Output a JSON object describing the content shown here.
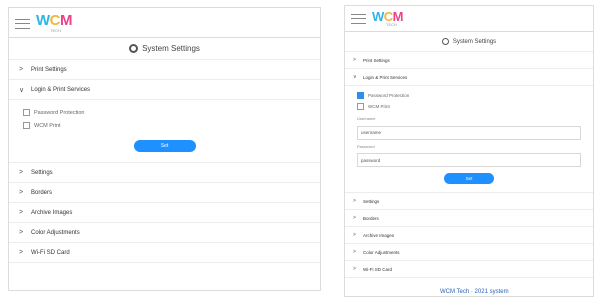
{
  "brand": {
    "logo_w": "W",
    "logo_c": "C",
    "logo_m": "M",
    "logo_sub": "TECH"
  },
  "title": "System Settings",
  "left": {
    "sections_top": [
      "Print Settings"
    ],
    "expanded_label": "Login & Print Services",
    "checkboxes": [
      {
        "label": "Password Protection",
        "checked": false
      },
      {
        "label": "WCM Print",
        "checked": false
      }
    ],
    "button": "Set",
    "sections_bottom": [
      "Settings",
      "Borders",
      "Archive Images",
      "Color Adjustments",
      "Wi-Fi SD Card"
    ]
  },
  "right": {
    "sections_top": [
      "Print Settings"
    ],
    "expanded_label": "Login & Print Services",
    "checkboxes": [
      {
        "label": "Password Protection",
        "checked": true
      },
      {
        "label": "WCM Print",
        "checked": false
      }
    ],
    "fields": [
      {
        "label": "Username",
        "value": "username"
      },
      {
        "label": "Password",
        "value": "password"
      }
    ],
    "button": "Set",
    "sections_bottom": [
      "Settings",
      "Borders",
      "Archive Images",
      "Color Adjustments",
      "Wi-Fi SD Card"
    ]
  },
  "footer": "WCM Tech · 2021 system"
}
